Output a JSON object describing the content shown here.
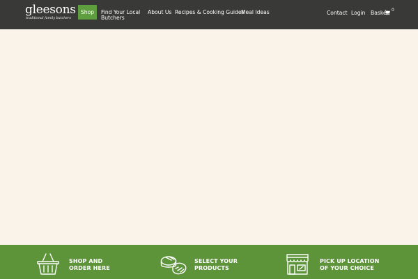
{
  "header": {
    "logo": {
      "word": "gleesons",
      "tagline": "traditional family butchers"
    },
    "nav": {
      "shop": "Shop",
      "find_line1": "Find Your Local",
      "find_line2": "Butchers",
      "about": "About Us",
      "recipes": "Recipes & Cooking Guides",
      "meal": "Meal Ideas",
      "contact": "Contact",
      "login": "Login",
      "basket": "Basket",
      "basket_count": "0"
    },
    "icons": {
      "cart": "shopping-cart-icon"
    }
  },
  "banner": {
    "steps": [
      {
        "icon": "basket-icon",
        "line1": "SHOP AND",
        "line2": "ORDER HERE"
      },
      {
        "icon": "meat-products-icon",
        "line1": "SELECT YOUR",
        "line2": "PRODUCTS"
      },
      {
        "icon": "shop-front-icon",
        "line1": "PICK UP LOCATION",
        "line2": "OF YOUR CHOICE"
      }
    ]
  },
  "colors": {
    "header_bg": "#393937",
    "accent_green": "#5f9e3e",
    "banner_green": "#5d943a",
    "page_bg": "#faf3ea",
    "text_light": "#ffffff"
  }
}
